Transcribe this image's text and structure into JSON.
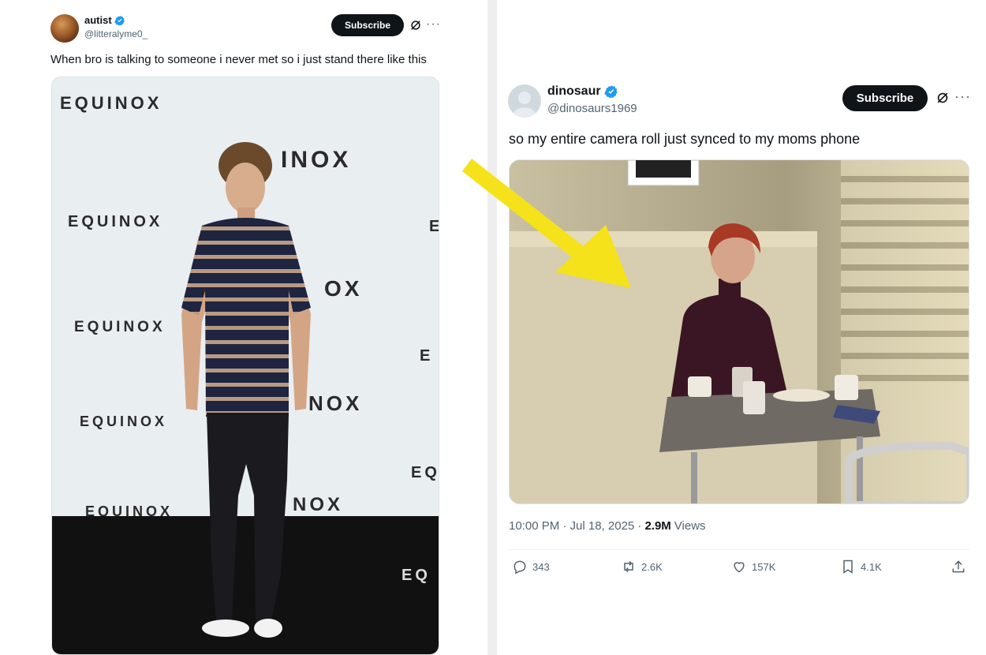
{
  "left_tweet": {
    "display_name": "autist",
    "handle": "@litteralyme0_",
    "subscribe_label": "Subscribe",
    "text": "When bro is talking to someone i never met so i just stand there like this",
    "photo_signage": [
      "EQUINOX",
      "EQUINOX",
      "EQUINOX",
      "EQUINOX",
      "EQUINOX",
      "INOX",
      "OX",
      "NOX",
      "NOX",
      "E",
      "E",
      "EQ",
      "EQ"
    ]
  },
  "right_tweet": {
    "display_name": "dinosaur",
    "handle": "@dinosaurs1969",
    "subscribe_label": "Subscribe",
    "text": "so my entire camera roll just synced to my moms phone",
    "timestamp": "10:00 PM · Jul 18, 2025 ·",
    "views_count": "2.9M",
    "views_label": "Views",
    "replies": "343",
    "reposts": "2.6K",
    "likes": "157K",
    "bookmarks": "4.1K"
  },
  "colors": {
    "verified": "#1d9bf0",
    "subscribe_bg": "#0f1419",
    "arrow": "#f5e21b",
    "muted_text": "#536471"
  },
  "icons": [
    "verified-badge-icon",
    "grok-icon",
    "more-icon",
    "reply-icon",
    "repost-icon",
    "like-icon",
    "bookmark-icon",
    "share-icon",
    "default-avatar-icon"
  ]
}
